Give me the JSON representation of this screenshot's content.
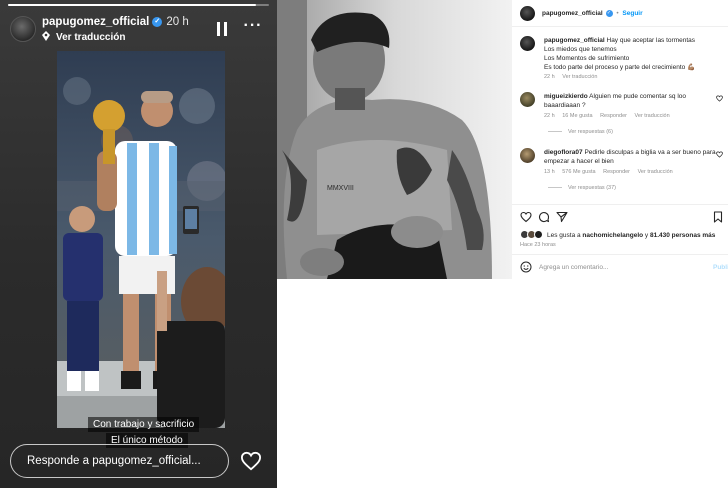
{
  "story": {
    "progress": 0.95,
    "username": "papugomez_official",
    "time_ago": "20 h",
    "translate_label": "Ver traducción",
    "caption_line1": "Con trabajo y sacrificio",
    "caption_line2": "El único método",
    "reply_placeholder": "Responde a papugomez_official..."
  },
  "post": {
    "username": "papugomez_official",
    "follow_label": "Seguir",
    "caption": {
      "username": "papugomez_official",
      "lines": [
        "Hay que aceptar las tormentas",
        "Los miedos que tenemos",
        "Los Momentos de sufrimiento",
        "Es todo parte del proceso y parte del crecimiento 💪🏽"
      ],
      "time": "22 h",
      "translate": "Ver traducción"
    },
    "comments": [
      {
        "username": "migueizkierdo",
        "text": "Alguien me pude comentar sq loo baaardiaaan ?",
        "time": "22 h",
        "likes": "16 Me gusta",
        "reply": "Responder",
        "translate": "Ver traducción",
        "replies": "Ver respuestas (6)"
      },
      {
        "username": "diegoflora07",
        "text": "Pedirle disculpas a biglia va a ser bueno para empezar a hacer el bien",
        "time": "13 h",
        "likes": "576 Me gusta",
        "reply": "Responder",
        "translate": "Ver traducción",
        "replies": "Ver respuestas (37)"
      }
    ],
    "likes_prefix": "Les gusta a",
    "likes_user": "nachomichelangelo",
    "likes_connector": "y",
    "likes_count": "81.430 personas más",
    "posted_ago": "Hace 23 horas",
    "comment_placeholder": "Agrega un comentario...",
    "publish_label": "Publicar"
  },
  "colors": {
    "accent": "#0095f6",
    "verified": "#3897f0",
    "story_bg": "#2b2b2b"
  }
}
